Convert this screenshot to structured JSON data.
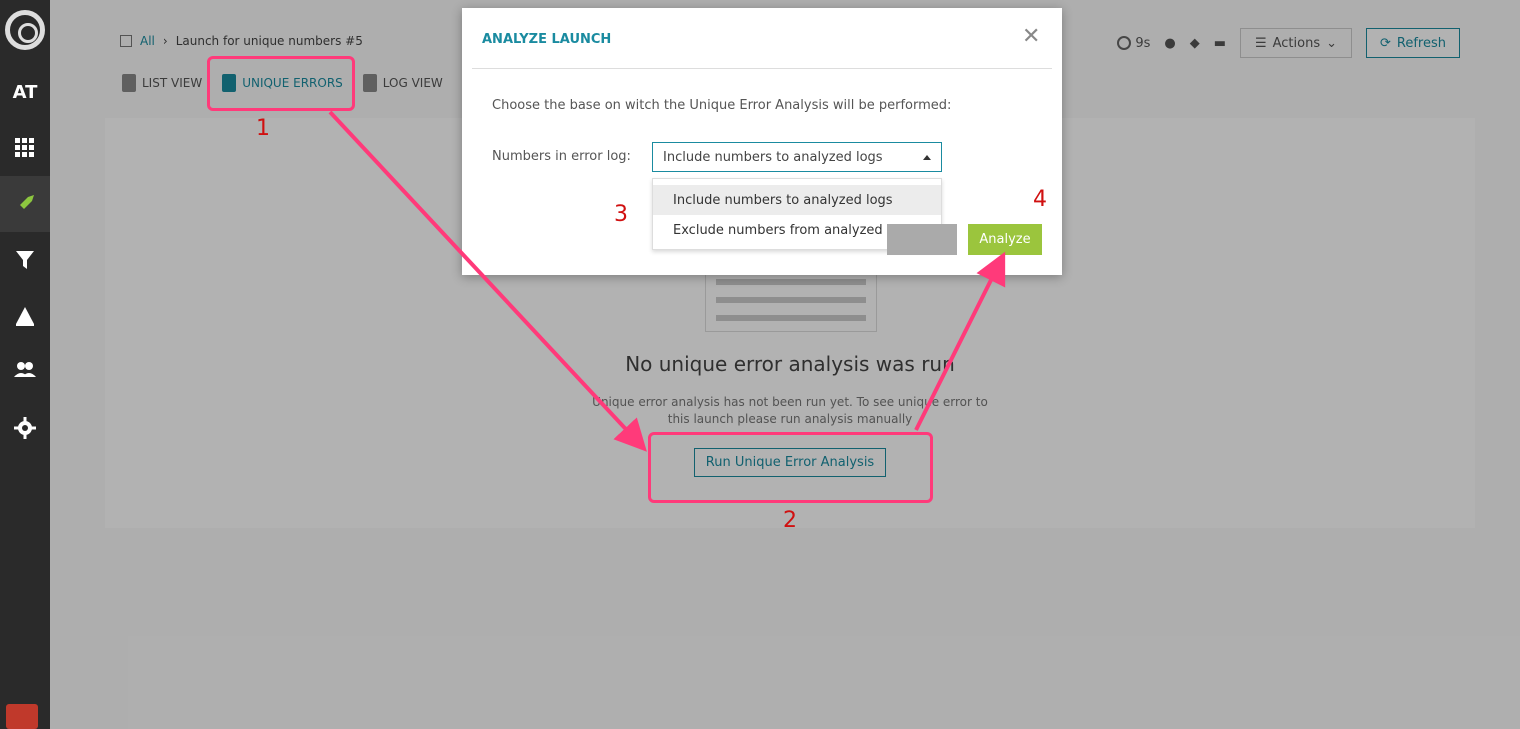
{
  "sidebar": {
    "items": [
      {
        "name": "at-logo",
        "label": "AT"
      },
      {
        "name": "apps-icon"
      },
      {
        "name": "rocket-icon"
      },
      {
        "name": "filter-icon"
      },
      {
        "name": "triangle-icon"
      },
      {
        "name": "users-icon"
      },
      {
        "name": "gear-icon"
      }
    ]
  },
  "breadcrumb": {
    "root": "All",
    "current": "Launch for unique numbers #5"
  },
  "tabs": {
    "list_view": "LIST VIEW",
    "unique_errors": "UNIQUE ERRORS",
    "log_view": "LOG VIEW"
  },
  "header": {
    "duration": "9s",
    "actions": "Actions",
    "refresh": "Refresh"
  },
  "empty_state": {
    "title": "No unique error analysis was run",
    "text": "Unique error analysis has not been run yet. To see unique error to this launch please run analysis manually",
    "run_button": "Run Unique Error Analysis"
  },
  "modal": {
    "title": "ANALYZE LAUNCH",
    "description": "Choose the base on witch the Unique Error Analysis will be performed:",
    "field_label": "Numbers in error log:",
    "selected": "Include numbers to analyzed logs",
    "options": [
      "Include numbers to analyzed logs",
      "Exclude numbers from analyzed logs"
    ],
    "analyze_button": "Analyze"
  },
  "annotations": [
    "1",
    "2",
    "3",
    "4"
  ],
  "colors": {
    "accent": "#1a8ba0",
    "highlight": "#ff3a7a",
    "analyze": "#9bc53d"
  }
}
